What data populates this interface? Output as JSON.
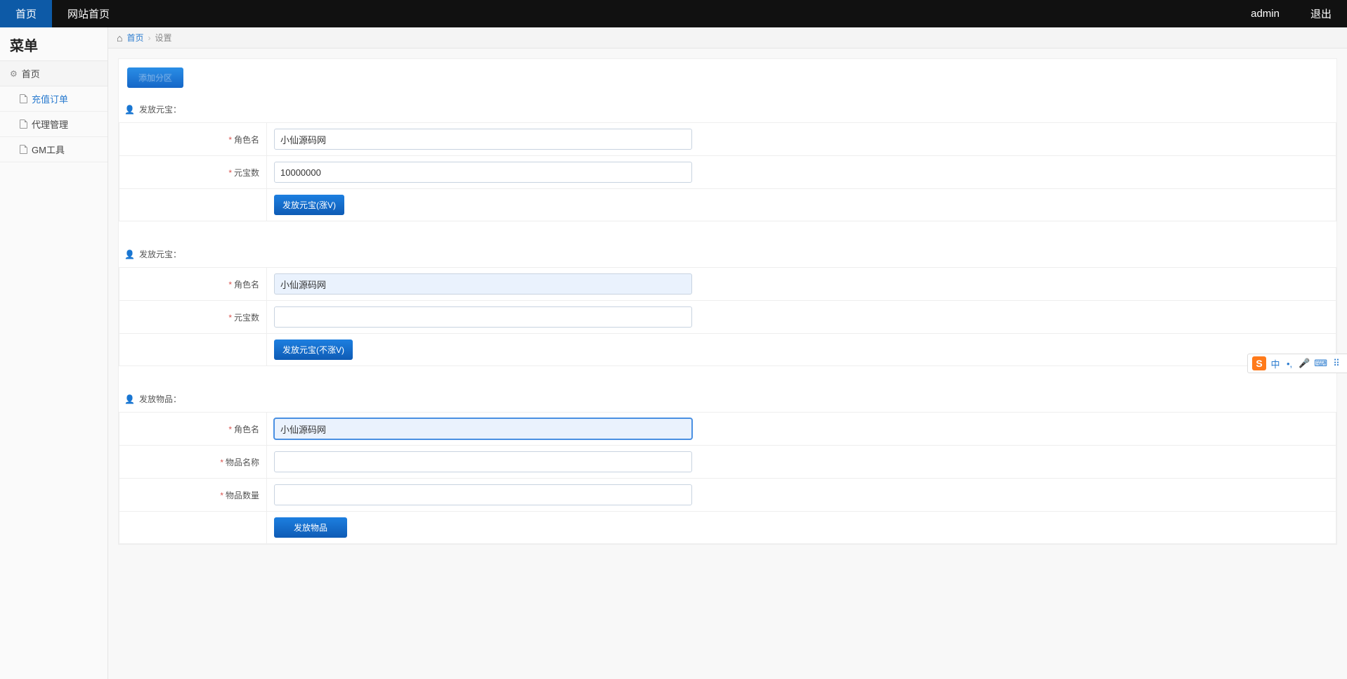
{
  "topbar": {
    "tabs": [
      {
        "label": "首页",
        "active": true
      },
      {
        "label": "网站首页",
        "active": false
      }
    ],
    "user": "admin",
    "logout": "退出"
  },
  "sidebar": {
    "title": "菜单",
    "root": "首页",
    "items": [
      {
        "label": "充值订单",
        "active": true
      },
      {
        "label": "代理管理",
        "active": false
      },
      {
        "label": "GM工具",
        "active": false
      }
    ]
  },
  "breadcrumb": {
    "home": "首页",
    "current": "设置"
  },
  "tag_button": "添加分区",
  "sections": [
    {
      "title": "发放元宝：",
      "fields": [
        {
          "label": "角色名",
          "value": "小仙源码网",
          "highlight": false
        },
        {
          "label": "元宝数",
          "value": "10000000",
          "highlight": false
        }
      ],
      "button": "发放元宝(涨V)"
    },
    {
      "title": "发放元宝：",
      "fields": [
        {
          "label": "角色名",
          "value": "小仙源码网",
          "highlight": true
        },
        {
          "label": "元宝数",
          "value": "",
          "highlight": false
        }
      ],
      "button": "发放元宝(不涨V)"
    },
    {
      "title": "发放物品：",
      "fields": [
        {
          "label": "角色名",
          "value": "小仙源码网",
          "highlight": true,
          "focus": true
        },
        {
          "label": "物品名称",
          "value": "",
          "highlight": false
        },
        {
          "label": "物品数量",
          "value": "",
          "highlight": false
        }
      ],
      "button": "发放物品",
      "button_wide": true
    }
  ],
  "ime": {
    "brand": "S",
    "items": [
      "中",
      "•,",
      "🎤",
      "⌨",
      "⠿"
    ]
  }
}
